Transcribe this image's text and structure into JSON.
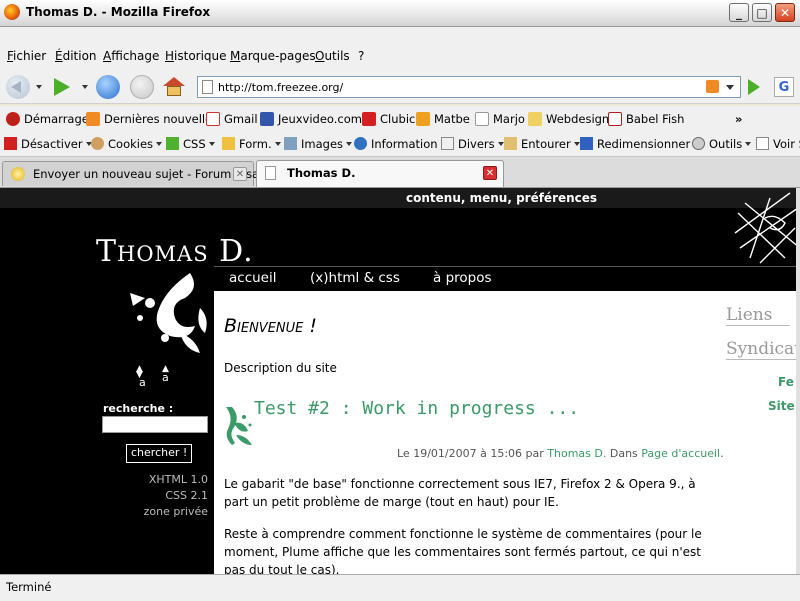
{
  "window": {
    "title": "Thomas D. - Mozilla Firefox"
  },
  "menu": [
    "Fichier",
    "Édition",
    "Affichage",
    "Historique",
    "Marque-pages",
    "Outils",
    "?"
  ],
  "url": "http://tom.freezee.org/",
  "bookmarks": [
    "Démarrage",
    "Dernières nouvelles",
    "Gmail",
    "Jeuxvideo.com",
    "Clubic",
    "Matbe",
    "Marjo",
    "Webdesign",
    "Babel Fish",
    "»"
  ],
  "devtools": [
    "Désactiver",
    "Cookies",
    "CSS",
    "Form.",
    "Images",
    "Information",
    "Divers",
    "Entourer",
    "Redimensionner",
    "Outils",
    "Voir S"
  ],
  "tabs": [
    {
      "label": "Envoyer un nouveau sujet - Forum Alsa...",
      "active": false
    },
    {
      "label": "Thomas D.",
      "active": true
    }
  ],
  "status": "Terminé",
  "page": {
    "topnav": "contenu, menu, préférences",
    "site_title": "Thomas D.",
    "nav": [
      "accueil",
      "(x)html & css",
      "à propos"
    ],
    "text_size": {
      "smaller": "a",
      "bigger": "a"
    },
    "search": {
      "label": "recherche :",
      "button": "chercher !"
    },
    "side_links": [
      "XHTML 1.0",
      "CSS 2.1",
      "zone privée"
    ],
    "welcome": "Bienvenue !",
    "description": "Description du site",
    "post": {
      "title": "Test #2 : Work in progress ...",
      "meta_prefix": "Le 19/01/2007 à 15:06 par",
      "author": "Thomas D.",
      "meta_mid": "Dans",
      "category": "Page d'accueil",
      "meta_end": ".",
      "paragraphs": [
        "Le gabarit \"de base\" fonctionne correctement sous IE7, Firefox 2 & Opera 9., à part un petit problème de marge (tout en haut) pour IE.",
        "Reste à comprendre comment fonctionne le système de commentaires (pour le moment, Plume affiche que les commentaires sont fermés partout, ce qui n'est pas du tout le cas)."
      ]
    },
    "right": {
      "links_heading": "Liens",
      "syndication_heading": "Syndicat",
      "feed_items": [
        "Fe",
        "Site"
      ]
    }
  },
  "colors": {
    "accent": "#3a9a68",
    "page_bg": "#000000"
  }
}
